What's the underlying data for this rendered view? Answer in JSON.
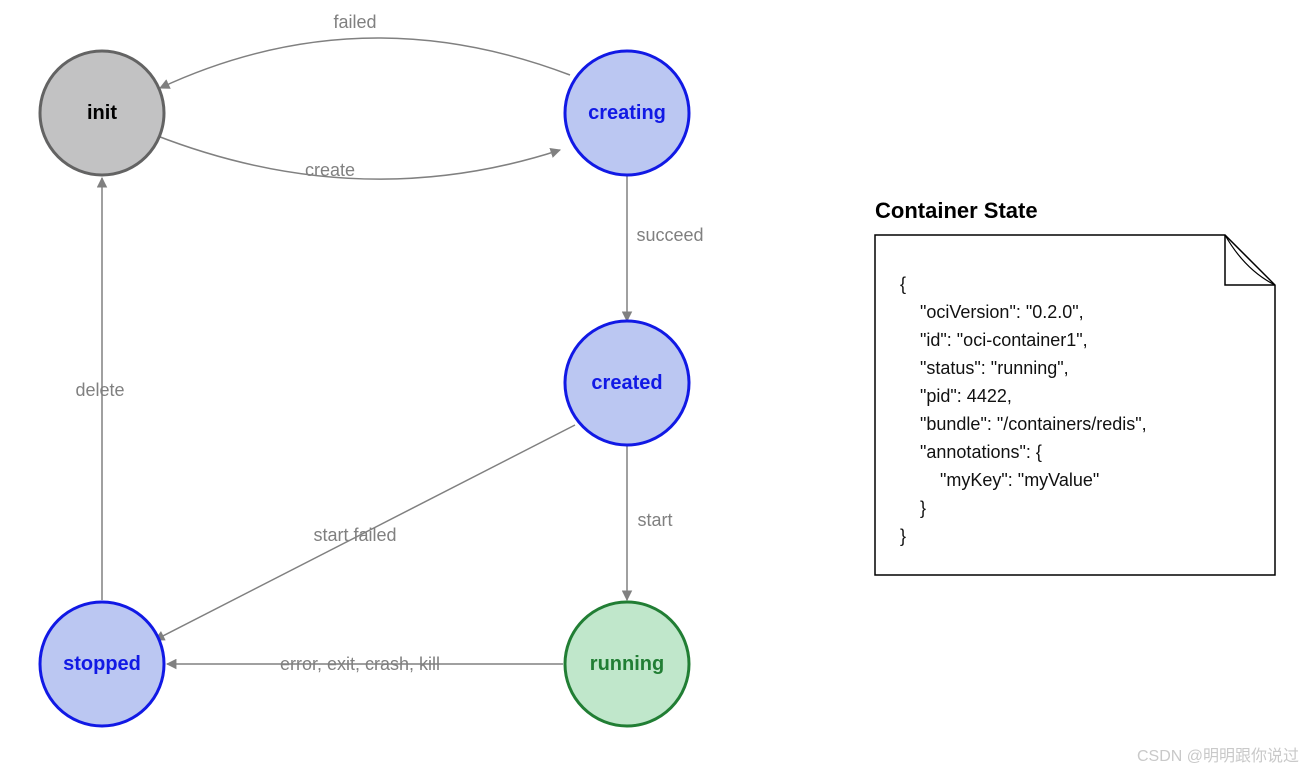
{
  "diagram": {
    "nodes": {
      "init": {
        "label": "init",
        "fill": "#c2c2c3",
        "stroke": "#636363",
        "text": "#000000"
      },
      "creating": {
        "label": "creating",
        "fill": "#bbc7f2",
        "stroke": "#1119e5",
        "text": "#1119e5"
      },
      "created": {
        "label": "created",
        "fill": "#bbc7f2",
        "stroke": "#1119e5",
        "text": "#1119e5"
      },
      "running": {
        "label": "running",
        "fill": "#c0e7cb",
        "stroke": "#217e34",
        "text": "#217e34"
      },
      "stopped": {
        "label": "stopped",
        "fill": "#bbc7f2",
        "stroke": "#1119e5",
        "text": "#1119e5"
      }
    },
    "edges": {
      "create": "create",
      "failed": "failed",
      "succeed": "succeed",
      "start": "start",
      "start_failed": "start failed",
      "error_exit": "error, exit, crash, kill",
      "delete": "delete"
    }
  },
  "panel": {
    "title": "Container State",
    "code_lines": [
      "{",
      "    \"ociVersion\": \"0.2.0\",",
      "    \"id\": \"oci-container1\",",
      "    \"status\": \"running\",",
      "    \"pid\": 4422,",
      "    \"bundle\": \"/containers/redis\",",
      "    \"annotations\": {",
      "        \"myKey\": \"myValue\"",
      "    }",
      "}"
    ]
  },
  "watermark": "CSDN @明明跟你说过"
}
